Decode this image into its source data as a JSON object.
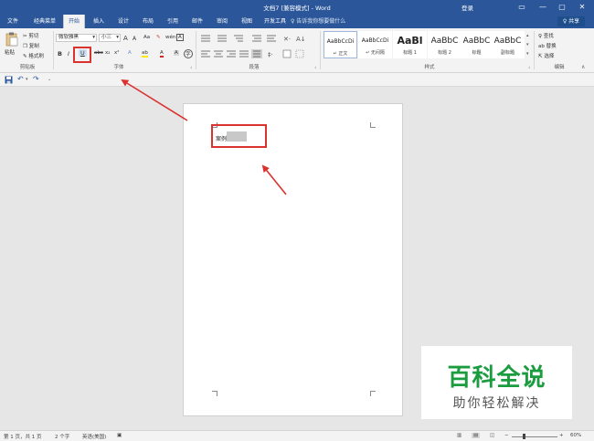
{
  "window": {
    "title": "文档7 [兼容模式] - Word",
    "login": "登录",
    "min": "—",
    "restore": "▢",
    "close": "✕",
    "ribbon_toggle": "▭"
  },
  "tabs": [
    "文件",
    "经典菜单",
    "开始",
    "插入",
    "设计",
    "布局",
    "引用",
    "邮件",
    "审阅",
    "视图",
    "开发工具"
  ],
  "tell_me": "♀ 告诉我你想要做什么",
  "share": "♀ 共享",
  "clipboard": {
    "paste": "粘贴",
    "cut": "剪切",
    "copy": "复制",
    "format_painter": "格式刷",
    "label": "剪贴板"
  },
  "font": {
    "name": "微软雅黑",
    "size": "小三",
    "grow": "A",
    "shrink": "A",
    "change_case": "Aa",
    "clear": "✎",
    "wen": "wén",
    "border_a": "A",
    "bold": "B",
    "italic": "I",
    "underline": "U",
    "strike": "abc",
    "subscript": "x₂",
    "superscript": "x²",
    "effects": "A",
    "highlight": "ab",
    "color": "A",
    "shade": "A",
    "circle": "字",
    "label": "字体"
  },
  "paragraph": {
    "label": "段落"
  },
  "styles": {
    "label": "样式",
    "items": [
      {
        "sample": "AaBbCcDi",
        "name": "↵ 正文"
      },
      {
        "sample": "AaBbCcDi",
        "name": "↵ 无间隔"
      },
      {
        "sample": "AaBl",
        "name": "标题 1"
      },
      {
        "sample": "AaBbC",
        "name": "标题 2"
      },
      {
        "sample": "AaBbC",
        "name": "标题"
      },
      {
        "sample": "AaBbC",
        "name": "副标题"
      }
    ]
  },
  "editing": {
    "find": "♀ 查找",
    "replace": "ab 替换",
    "select": "⇱ 选择",
    "label": "编辑"
  },
  "document": {
    "text": "案例"
  },
  "watermark": {
    "title": "百科全说",
    "subtitle": "助你轻松解决"
  },
  "status": {
    "pages": "第 1 页，共 1 页",
    "words": "2 个字",
    "lang": "英语(美国)",
    "zoom": "60%",
    "minus": "−",
    "plus": "+"
  }
}
